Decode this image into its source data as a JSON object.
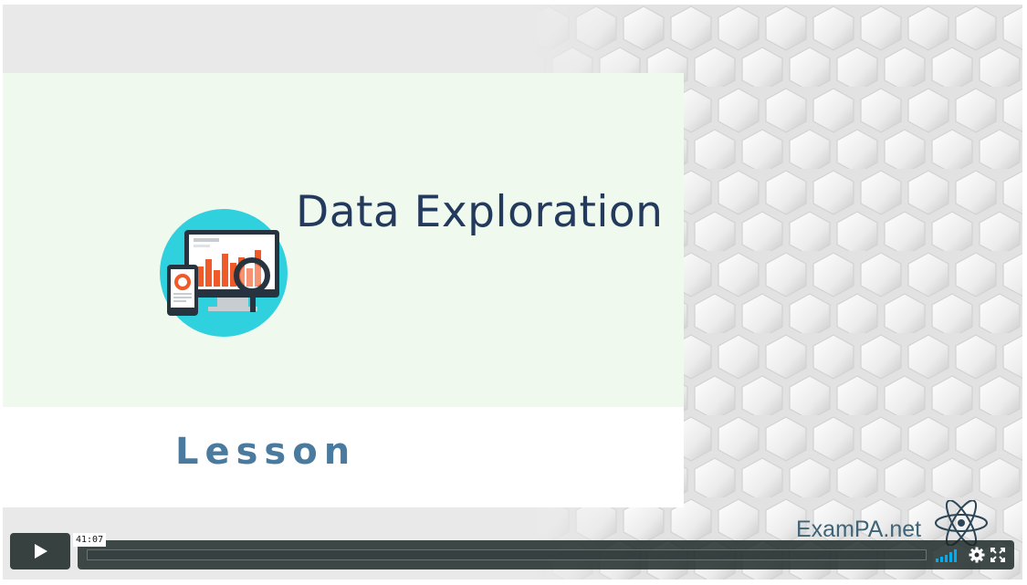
{
  "slide": {
    "title": "Data Exploration",
    "subtitle": "Lesson",
    "brand_text": "ExamPA.net"
  },
  "player": {
    "duration_label": "41:07",
    "progress_fraction": 0,
    "controls": {
      "play_icon": "play-icon",
      "volume_icon": "volume-bars-icon",
      "settings_icon": "gear-icon",
      "fullscreen_icon": "fullscreen-icon"
    }
  },
  "colors": {
    "title": "#233a5c",
    "subtitle": "#4a7a9e",
    "slide_background": "#eff9ee",
    "control_bar": "#172322",
    "volume_accent": "#00adef",
    "icon_circle": "#2ed1dd",
    "chart_bars": "#f05a28"
  }
}
